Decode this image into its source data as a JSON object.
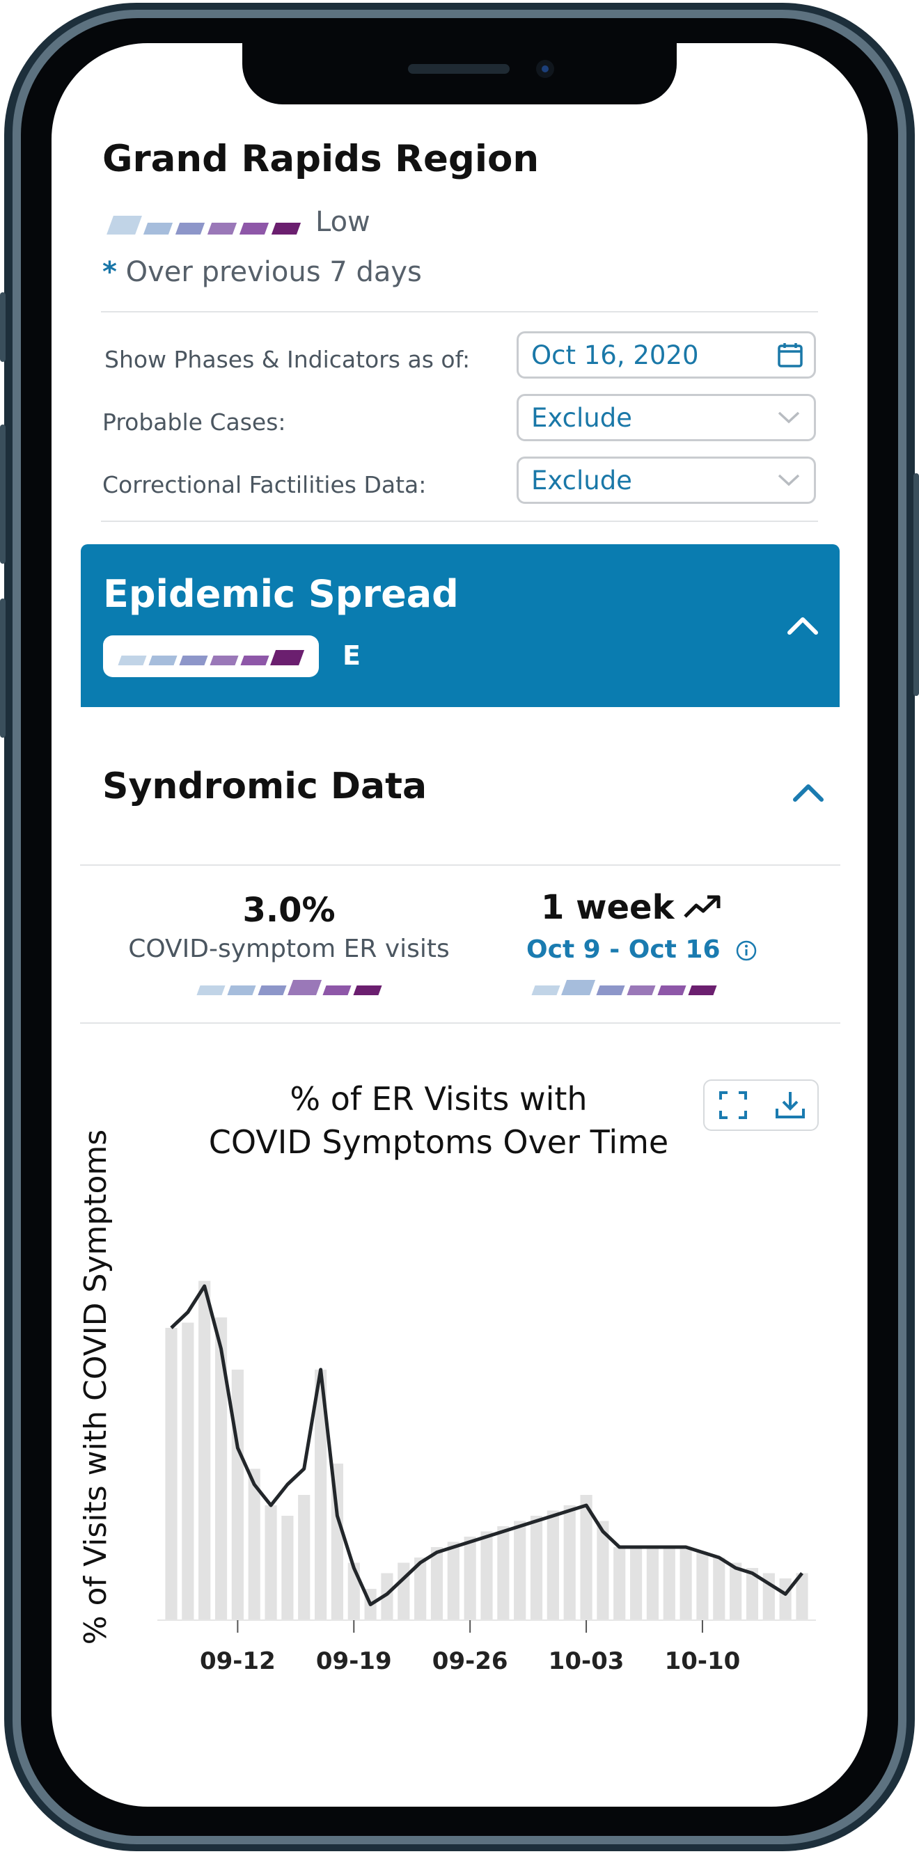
{
  "header": {
    "region_title": "Grand Rapids Region",
    "risk_level": "Low",
    "note_star": "*",
    "note_text": "Over previous 7 days"
  },
  "risk_scale_colors": [
    "#c1d4e7",
    "#a6bddc",
    "#8d96c9",
    "#9a78b8",
    "#8e57a8",
    "#6b1f6f"
  ],
  "filters": {
    "phases_label": "Show Phases & Indicators as of:",
    "phases_value": "Oct 16, 2020",
    "probable_label": "Probable Cases:",
    "probable_value": "Exclude",
    "correctional_label": "Correctional Factilities Data:",
    "correctional_value": "Exclude"
  },
  "epidemic_spread": {
    "title": "Epidemic Spread",
    "level_letter": "E",
    "accent_color": "#0a7cb0"
  },
  "syndromic": {
    "title": "Syndromic Data",
    "metric_value": "3.0%",
    "metric_label": "COVID-symptom ER visits",
    "trend_value": "1 week",
    "trend_dates": "Oct 9 - Oct 16"
  },
  "chart_data": {
    "type": "bar",
    "title_line1": "% of ER Visits with",
    "title_line2": "COVID Symptoms Over Time",
    "xlabel": "",
    "ylabel": "% of Visits with COVID Symptoms",
    "x_ticks": [
      "09-12",
      "09-19",
      "09-26",
      "10-03",
      "10-10"
    ],
    "days": [
      "09-08",
      "09-09",
      "09-10",
      "09-11",
      "09-12",
      "09-13",
      "09-14",
      "09-15",
      "09-16",
      "09-17",
      "09-18",
      "09-19",
      "09-20",
      "09-21",
      "09-22",
      "09-23",
      "09-24",
      "09-25",
      "09-26",
      "09-27",
      "09-28",
      "09-29",
      "09-30",
      "10-01",
      "10-02",
      "10-03",
      "10-04",
      "10-05",
      "10-06",
      "10-07",
      "10-08",
      "10-09",
      "10-10",
      "10-11",
      "10-12",
      "10-13",
      "10-14",
      "10-15",
      "10-16"
    ],
    "series": [
      {
        "values": [
          5.6,
          5.7,
          6.5,
          5.8,
          4.8,
          2.9,
          2.2,
          2.0,
          2.4,
          4.8,
          3.0,
          1.1,
          0.6,
          0.9,
          1.1,
          1.2,
          1.4,
          1.5,
          1.6,
          1.7,
          1.8,
          1.9,
          2.0,
          2.1,
          2.2,
          2.4,
          1.9,
          1.4,
          1.4,
          1.4,
          1.4,
          1.4,
          1.3,
          1.2,
          1.1,
          1.0,
          0.9,
          0.8,
          0.9
        ]
      },
      {
        "values": [
          5.6,
          5.9,
          6.4,
          5.2,
          3.3,
          2.6,
          2.2,
          2.6,
          2.9,
          4.8,
          2.0,
          1.0,
          0.3,
          0.5,
          0.8,
          1.1,
          1.3,
          1.4,
          1.5,
          1.6,
          1.7,
          1.8,
          1.9,
          2.0,
          2.1,
          2.2,
          1.7,
          1.4,
          1.4,
          1.4,
          1.4,
          1.4,
          1.3,
          1.2,
          1.0,
          0.9,
          0.7,
          0.5,
          0.9
        ]
      }
    ],
    "ylim": [
      0,
      8
    ],
    "bar_color": "#e2e2e2",
    "line_color": "#22262a",
    "grid": false
  },
  "icons": {
    "calendar": "calendar-icon",
    "dropdown": "chevron-down-icon",
    "collapse": "chevron-up-icon",
    "trend": "trending-up-icon",
    "info": "info-icon",
    "fullscreen": "expand-icon",
    "download": "download-icon"
  }
}
